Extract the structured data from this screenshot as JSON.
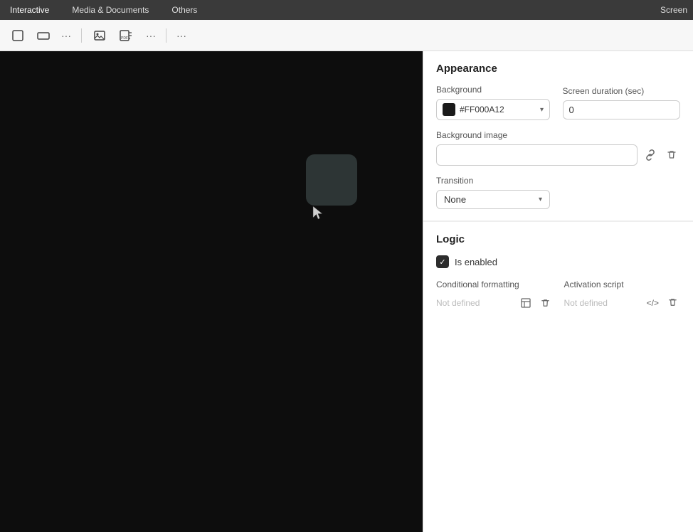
{
  "topnav": {
    "items": [
      {
        "label": "Interactive",
        "active": true
      },
      {
        "label": "Media & Documents",
        "active": false
      },
      {
        "label": "Others",
        "active": false
      }
    ],
    "screen_label": "Screen"
  },
  "toolbar": {
    "btn1": "⬜",
    "btn2": "▭",
    "dots1": "···",
    "btn3": "🖼",
    "btn4": "PDF",
    "dots2": "···",
    "dots3": "···"
  },
  "appearance": {
    "section_title": "Appearance",
    "background_label": "Background",
    "background_color": "#FF000A12",
    "screen_duration_label": "Screen duration (sec)",
    "screen_duration_value": "0",
    "background_image_label": "Background image",
    "background_image_placeholder": "",
    "transition_label": "Transition",
    "transition_value": "None"
  },
  "logic": {
    "section_title": "Logic",
    "is_enabled_label": "Is enabled",
    "conditional_formatting_label": "Conditional formatting",
    "conditional_formatting_value": "Not defined",
    "activation_script_label": "Activation script",
    "activation_script_value": "Not defined"
  },
  "icons": {
    "link": "🔗",
    "trash": "🗑",
    "code": "</>",
    "table": "⊞",
    "check": "✓",
    "chevron_down": "▾"
  }
}
